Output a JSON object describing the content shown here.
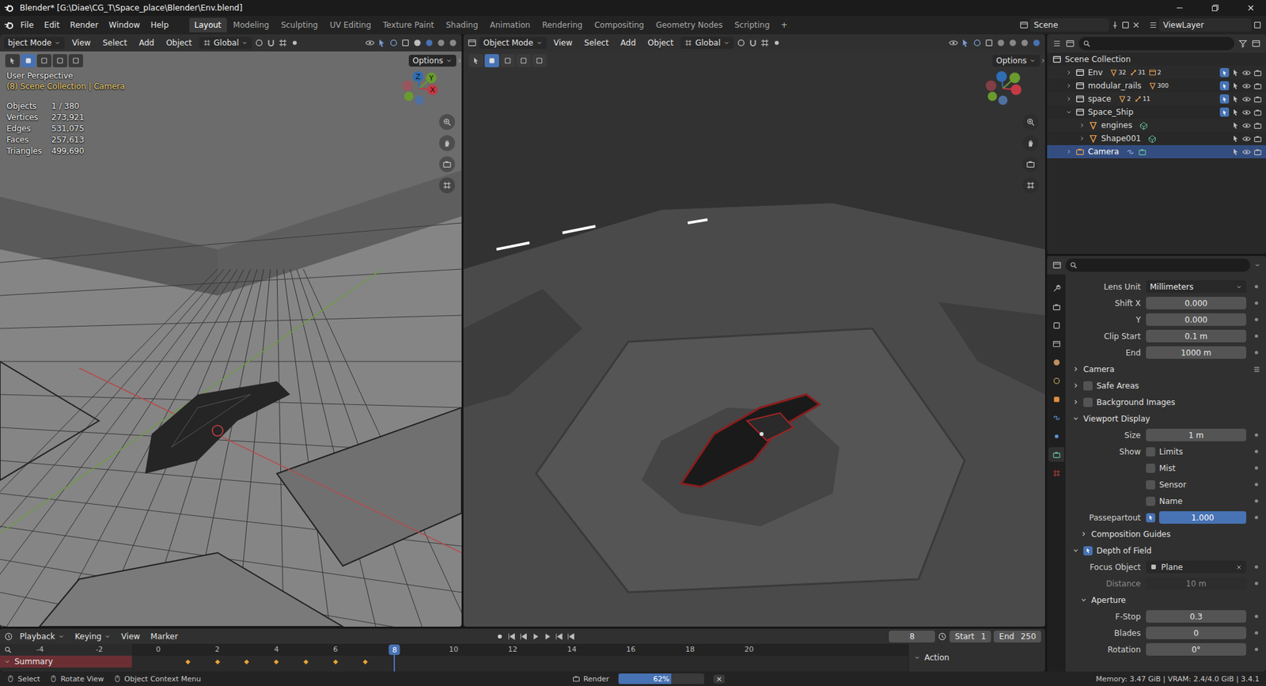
{
  "window": {
    "title": "Blender* [G:\\Diae\\CG_T\\Space_place\\Blender\\Env.blend]"
  },
  "menus": [
    "File",
    "Edit",
    "Render",
    "Window",
    "Help"
  ],
  "workspaces": [
    {
      "label": "Layout",
      "selected": true
    },
    {
      "label": "Modeling",
      "selected": false
    },
    {
      "label": "Sculpting",
      "selected": false
    },
    {
      "label": "UV Editing",
      "selected": false
    },
    {
      "label": "Texture Paint",
      "selected": false
    },
    {
      "label": "Shading",
      "selected": false
    },
    {
      "label": "Animation",
      "selected": false
    },
    {
      "label": "Rendering",
      "selected": false
    },
    {
      "label": "Compositing",
      "selected": false
    },
    {
      "label": "Geometry Nodes",
      "selected": false
    },
    {
      "label": "Scripting",
      "selected": false
    }
  ],
  "add_workspace": "+",
  "scene": "Scene",
  "view_layer": "ViewLayer",
  "viewports": [
    {
      "mode": "bject Mode",
      "menus": [
        "View",
        "Select",
        "Add",
        "Object"
      ],
      "orientation": "Global",
      "options": "Options",
      "shading": "wireframe",
      "overlay": {
        "title": "User Perspective",
        "context": "(8) Scene Collection | Camera",
        "stats": [
          {
            "label": "Objects",
            "value": "1 / 380"
          },
          {
            "label": "Vertices",
            "value": "273,921"
          },
          {
            "label": "Edges",
            "value": "531,075"
          },
          {
            "label": "Faces",
            "value": "257,613"
          },
          {
            "label": "Triangles",
            "value": "499,690"
          }
        ]
      },
      "gizmo": [
        "Z",
        "Y",
        "X"
      ]
    },
    {
      "mode": "Object Mode",
      "menus": [
        "View",
        "Select",
        "Add",
        "Object"
      ],
      "orientation": "Global",
      "options": "Options",
      "shading": "rendered",
      "overlay": null,
      "gizmo": []
    }
  ],
  "outliner": {
    "root": "Scene Collection",
    "items": [
      {
        "name": "Env",
        "kind": "collection",
        "depth": 0,
        "expanded": false,
        "selected": false,
        "checked": true,
        "badges": [
          "32",
          "31",
          "2"
        ]
      },
      {
        "name": "modular_rails",
        "kind": "collection",
        "depth": 0,
        "expanded": false,
        "selected": false,
        "checked": true,
        "badges": [
          "300"
        ]
      },
      {
        "name": "space",
        "kind": "collection",
        "depth": 0,
        "expanded": false,
        "selected": false,
        "checked": true,
        "badges": [
          "2",
          "11"
        ]
      },
      {
        "name": "Space_Ship",
        "kind": "collection",
        "depth": 0,
        "expanded": true,
        "selected": false,
        "checked": true,
        "badges": []
      },
      {
        "name": "engines",
        "kind": "mesh",
        "depth": 1,
        "expanded": false,
        "selected": false,
        "badges": []
      },
      {
        "name": "Shape001",
        "kind": "mesh",
        "depth": 1,
        "expanded": false,
        "selected": false,
        "badges": []
      },
      {
        "name": "Camera",
        "kind": "camera",
        "depth": 0,
        "expanded": false,
        "selected": true,
        "badges": []
      }
    ]
  },
  "property_tabs": [
    {
      "selected": false
    },
    {
      "selected": false
    },
    {
      "selected": false
    },
    {
      "selected": false
    },
    {
      "selected": false
    },
    {
      "selected": false
    },
    {
      "selected": false
    },
    {
      "selected": false
    },
    {
      "selected": false
    },
    {
      "selected": true
    },
    {
      "selected": false
    }
  ],
  "properties": [
    {
      "kind": "dropdown",
      "label": "Lens Unit",
      "value": "Millimeters"
    },
    {
      "kind": "number",
      "label": "Shift X",
      "value": "0.000",
      "disabled": false
    },
    {
      "kind": "number",
      "label": "Y",
      "value": "0.000",
      "disabled": false
    },
    {
      "kind": "number",
      "label": "Clip Start",
      "value": "0.1 m",
      "disabled": false
    },
    {
      "kind": "number",
      "label": "End",
      "value": "1000 m",
      "disabled": false
    },
    {
      "kind": "panel",
      "label": "Camera",
      "expanded": false,
      "depth": 0,
      "has_checkbox": false,
      "checked": false
    },
    {
      "kind": "panel",
      "label": "Safe Areas",
      "expanded": false,
      "depth": 0,
      "has_checkbox": true,
      "checked": false
    },
    {
      "kind": "panel",
      "label": "Background Images",
      "expanded": false,
      "depth": 0,
      "has_checkbox": true,
      "checked": false
    },
    {
      "kind": "panel",
      "label": "Viewport Display",
      "expanded": true,
      "depth": 0,
      "has_checkbox": false,
      "checked": false
    },
    {
      "kind": "number",
      "label": "Size",
      "value": "1 m",
      "disabled": false
    },
    {
      "kind": "checkbox",
      "label": "Show",
      "text": "Limits",
      "checked": false
    },
    {
      "kind": "checkbox",
      "label": "",
      "text": "Mist",
      "checked": false
    },
    {
      "kind": "checkbox",
      "label": "",
      "text": "Sensor",
      "checked": false
    },
    {
      "kind": "checkbox",
      "label": "",
      "text": "Name",
      "checked": false
    },
    {
      "kind": "slider",
      "label": "Passepartout",
      "value": "1.000",
      "level": 1,
      "checked": true
    },
    {
      "kind": "panel",
      "label": "Composition Guides",
      "expanded": false,
      "depth": 1,
      "has_checkbox": false,
      "checked": false
    },
    {
      "kind": "panel",
      "label": "Depth of Field",
      "expanded": true,
      "depth": 0,
      "has_checkbox": true,
      "checked": true
    },
    {
      "kind": "object",
      "label": "Focus Object",
      "value": "Plane"
    },
    {
      "kind": "number",
      "label": "Distance",
      "value": "10 m",
      "disabled": true
    },
    {
      "kind": "panel",
      "label": "Aperture",
      "expanded": true,
      "depth": 1,
      "has_checkbox": false,
      "checked": false
    },
    {
      "kind": "number",
      "label": "F-Stop",
      "value": "0.3",
      "disabled": false
    },
    {
      "kind": "number",
      "label": "Blades",
      "value": "0",
      "disabled": false
    },
    {
      "kind": "number",
      "label": "Rotation",
      "value": "0°",
      "disabled": false
    }
  ],
  "timeline": {
    "menus": [
      "Playback",
      "Keying",
      "View",
      "Marker"
    ],
    "current_frame": "8",
    "start_label": "Start",
    "start": "1",
    "end_label": "End",
    "end": "250",
    "ruler": [
      "-4",
      "-2",
      "0",
      "2",
      "4",
      "6",
      "8",
      "10",
      "12",
      "14",
      "16",
      "18",
      "20"
    ],
    "channel": "Summary",
    "keyframes": [
      1,
      2,
      3,
      4,
      5,
      6,
      7
    ],
    "sidebar_title": "Action"
  },
  "status_bar": {
    "hints": [
      "Select",
      "Rotate View",
      "Object Context Menu"
    ],
    "job": "Render",
    "progress": {
      "level": 0.62,
      "reading": "62%"
    },
    "cancel": "×",
    "info": "Memory: 3.47 GiB | VRAM: 2.4/4.0 GiB | 3.4.1"
  }
}
